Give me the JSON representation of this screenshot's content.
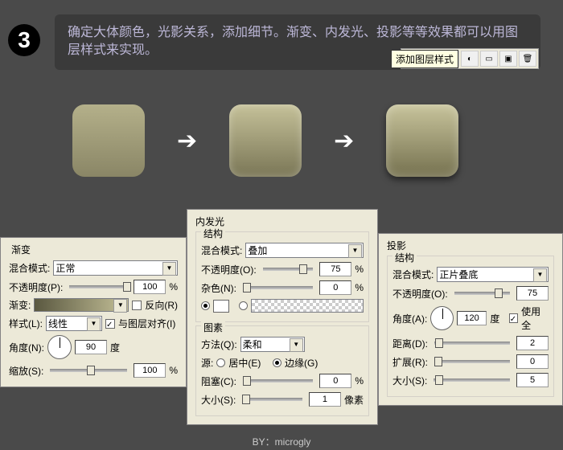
{
  "step_number": "3",
  "description": "确定大体颜色，光影关系，添加细节。渐变、内发光、投影等等效果都可以用图层样式来实现。",
  "tooltip": "添加图层样式",
  "panels": {
    "gradient": {
      "title": "渐变",
      "blend_label": "混合模式:",
      "blend_value": "正常",
      "opacity_label": "不透明度(P):",
      "opacity_value": "100",
      "gradient_label": "渐变:",
      "reverse_label": "反向(R)",
      "style_label": "样式(L):",
      "style_value": "线性",
      "align_label": "与图层对齐(I)",
      "angle_label": "角度(N):",
      "angle_value": "90",
      "angle_unit": "度",
      "scale_label": "缩放(S):",
      "scale_value": "100",
      "percent": "%"
    },
    "glow": {
      "title": "内发光",
      "struct": "结构",
      "blend_label": "混合模式:",
      "blend_value": "叠加",
      "opacity_label": "不透明度(O):",
      "opacity_value": "75",
      "noise_label": "杂色(N):",
      "noise_value": "0",
      "elements": "图素",
      "method_label": "方法(Q):",
      "method_value": "柔和",
      "source_label": "源:",
      "source_center": "居中(E)",
      "source_edge": "边缘(G)",
      "choke_label": "阻塞(C):",
      "choke_value": "0",
      "size_label": "大小(S):",
      "size_value": "1",
      "px": "像素",
      "percent": "%"
    },
    "shadow": {
      "title": "投影",
      "struct": "结构",
      "blend_label": "混合模式:",
      "blend_value": "正片叠底",
      "opacity_label": "不透明度(O):",
      "opacity_value": "75",
      "angle_label": "角度(A):",
      "angle_value": "120",
      "angle_unit": "度",
      "global_label": "使用全",
      "distance_label": "距离(D):",
      "distance_value": "2",
      "spread_label": "扩展(R):",
      "spread_value": "0",
      "size_label": "大小(S):",
      "size_value": "5"
    }
  },
  "credit": "BY：microgly"
}
